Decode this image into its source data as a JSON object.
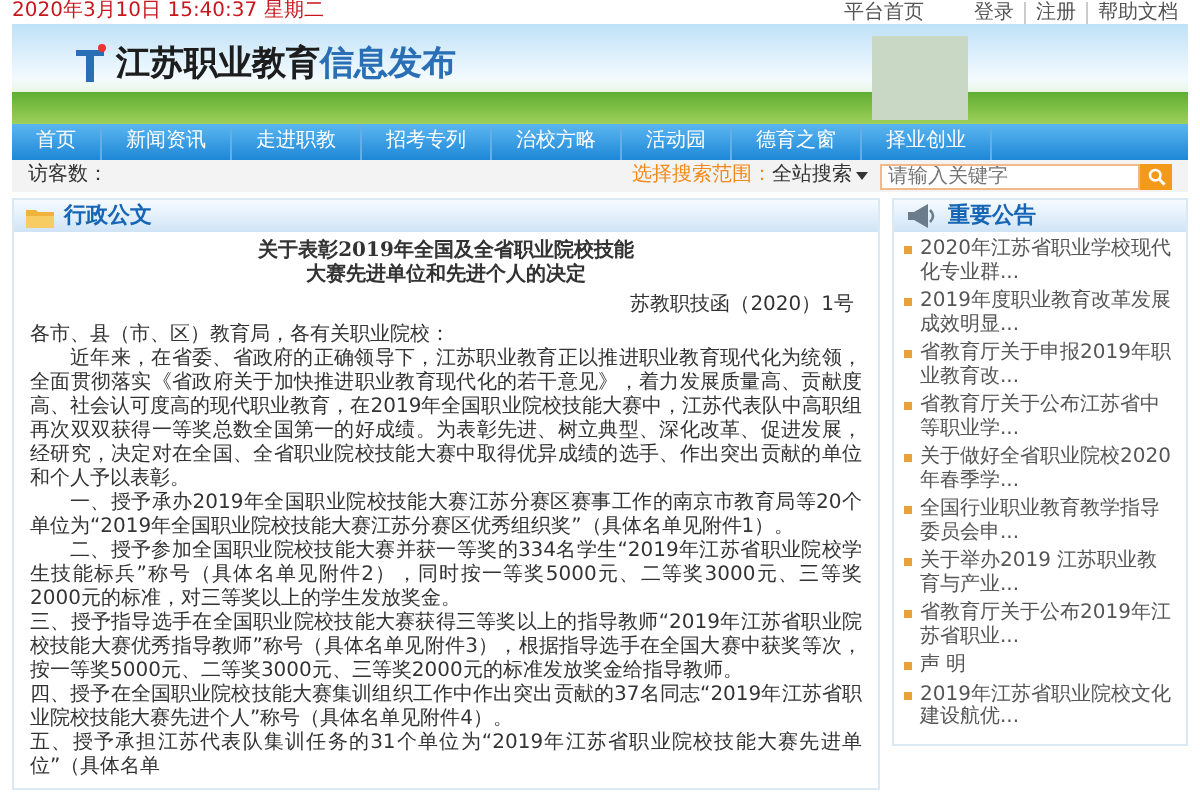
{
  "top_bar": {
    "datetime": "2020年3月10日 15:40:37 星期二",
    "home_link": "平台首页",
    "links": [
      "登录",
      "注册",
      "帮助文档"
    ]
  },
  "banner": {
    "title_parts": [
      {
        "text": "江苏职业教育",
        "kind": "dark"
      },
      {
        "text": "信息发布",
        "kind": "accent"
      }
    ]
  },
  "nav": [
    "首页",
    "新闻资讯",
    "走进职教",
    "招考专列",
    "治校方略",
    "活动园",
    "德育之窗",
    "择业创业"
  ],
  "search_bar": {
    "visitors_label": "访客数：",
    "scope_label": "选择搜索范围：",
    "scope_value": "全站搜索",
    "placeholder": "请输入关键字"
  },
  "article_panel": {
    "heading": "行政公文",
    "title_lines": [
      "关于表彰2019年全国及全省职业院校技能",
      "大赛先进单位和先进个人的决定"
    ],
    "doc_number": "苏教职技函（2020）1号",
    "paragraphs": [
      {
        "text": "各市、县（市、区）教育局，各有关职业院校：",
        "indent": false
      },
      {
        "text": "近年来，在省委、省政府的正确领导下，江苏职业教育正以推进职业教育现代化为统领，全面贯彻落实《省政府关于加快推进职业教育现代化的若干意见》，着力发展质量高、贡献度高、社会认可度高的现代职业教育，在2019年全国职业院校技能大赛中，江苏代表队中高职组再次双双获得一等奖总数全国第一的好成绩。为表彰先进、树立典型、深化改革、促进发展，经研究，决定对在全国、全省职业院校技能大赛中取得优异成绩的选手、作出突出贡献的单位和个人予以表彰。",
        "indent": true
      },
      {
        "text": "一、授予承办2019年全国职业院校技能大赛江苏分赛区赛事工作的南京市教育局等20个单位为“2019年全国职业院校技能大赛江苏分赛区优秀组织奖”（具体名单见附件1）。",
        "indent": true
      },
      {
        "text": "二、授予参加全国职业院校技能大赛并获一等奖的334名学生“2019年江苏省职业院校学生技能标兵”称号（具体名单见附件2），同时按一等奖5000元、二等奖3000元、三等奖2000元的标准，对三等奖以上的学生发放奖金。",
        "indent": true
      },
      {
        "text": "三、授予指导选手在全国职业院校技能大赛获得三等奖以上的指导教师“2019年江苏省职业院校技能大赛优秀指导教师”称号（具体名单见附件3），根据指导选手在全国大赛中获奖等次，按一等奖5000元、二等奖3000元、三等奖2000元的标准发放奖金给指导教师。",
        "indent": false
      },
      {
        "text": "四、授予在全国职业院校技能大赛集训组织工作中作出突出贡献的37名同志“2019年江苏省职业院校技能大赛先进个人”称号（具体名单见附件4）。",
        "indent": false
      },
      {
        "text": "五、授予承担江苏代表队集训任务的31个单位为“2019年江苏省职业院校技能大赛先进单位”（具体名单",
        "indent": false
      }
    ]
  },
  "notice_panel": {
    "heading": "重要公告",
    "items": [
      "2020年江苏省职业学校现代化专业群...",
      "2019年度职业教育改革发展成效明显...",
      "省教育厅关于申报2019年职业教育改...",
      "省教育厅关于公布江苏省中等职业学...",
      "关于做好全省职业院校2020年春季学...",
      "全国行业职业教育教学指导委员会申...",
      "关于举办2019 江苏职业教育与产业...",
      "省教育厅关于公布2019年江苏省职业...",
      "声 明",
      "2019年江苏省职业院校文化建设航优..."
    ]
  }
}
